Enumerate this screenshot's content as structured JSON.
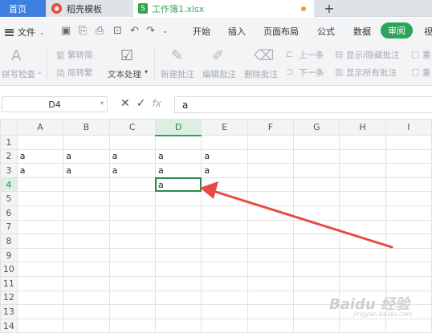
{
  "tabs": [
    {
      "label": "首页"
    },
    {
      "label": "稻壳模板",
      "icon": "docer-logo"
    },
    {
      "label": "工作簿1.xlsx",
      "icon": "spreadsheet-logo",
      "logo_letter": "S",
      "unsaved_dot": true
    },
    {
      "label": "+"
    }
  ],
  "menubar": {
    "file_label": "文件",
    "items": [
      "开始",
      "插入",
      "页面布局",
      "公式",
      "数据",
      "审阅",
      "视"
    ],
    "active": "审阅"
  },
  "ribbon": {
    "spell_check": "拼写检查",
    "trad_simp": "繁转简",
    "simp_trad": "简转繁",
    "text_process": "文本处理",
    "new_comment": "新建批注",
    "edit_comment": "编辑批注",
    "delete_comment": "删除批注",
    "prev": "上一条",
    "next": "下一条",
    "show_hide_comment": "显示/隐藏批注",
    "show_all_comments": "显示所有批注",
    "clipped_1": "重",
    "clipped_2": "重"
  },
  "formula_bar": {
    "name_box": "D4",
    "fx_label": "fx",
    "value": "a"
  },
  "sheet": {
    "columns": [
      "A",
      "B",
      "C",
      "D",
      "E",
      "F",
      "G",
      "H",
      "I"
    ],
    "rows": [
      "1",
      "2",
      "3",
      "4",
      "5",
      "6",
      "7",
      "8",
      "9",
      "10",
      "11",
      "12",
      "13",
      "14"
    ],
    "active_cell": "D4",
    "cells": {
      "A2": "a",
      "B2": "a",
      "C2": "a",
      "D2": "a",
      "E2": "a",
      "A3": "a",
      "B3": "a",
      "C3": "a",
      "D3": "a",
      "E3": "a",
      "D4": "a"
    }
  },
  "annotation": {
    "color": "#e84a47"
  },
  "watermark": {
    "main": "Baidu 经验",
    "sub": "jingyan.baidu.com"
  },
  "colors": {
    "accent_green": "#2aa55a",
    "tab_blue": "#3e7fe0"
  }
}
